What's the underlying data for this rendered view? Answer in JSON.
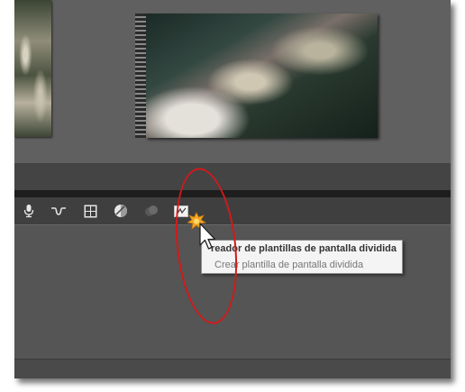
{
  "toolbar": {
    "icons": [
      {
        "name": "microphone-icon"
      },
      {
        "name": "audio-waveform-icon"
      },
      {
        "name": "grid-layout-icon"
      },
      {
        "name": "color-correction-icon"
      },
      {
        "name": "disabled-effect-icon"
      },
      {
        "name": "split-screen-template-icon"
      }
    ]
  },
  "tooltip": {
    "title": "reador de plantillas de pantalla dividida",
    "description": "Crear plantilla de pantalla dividida"
  },
  "colors": {
    "annotation": "#d11a1a",
    "click_burst": "#f5a623"
  }
}
